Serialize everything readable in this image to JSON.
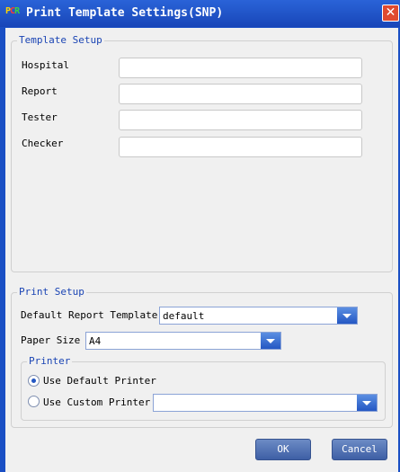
{
  "window": {
    "title": "Print Template Settings(SNP)",
    "icon_text": "PCR",
    "close_symbol": "✕"
  },
  "template_setup": {
    "legend": "Template Setup",
    "fields": [
      {
        "label": "Hospital",
        "value": ""
      },
      {
        "label": "Report",
        "value": ""
      },
      {
        "label": "Tester",
        "value": ""
      },
      {
        "label": "Checker",
        "value": ""
      }
    ]
  },
  "print_setup": {
    "legend": "Print Setup",
    "default_report_template_label": "Default Report Template",
    "default_report_template_value": "default",
    "paper_size_label": "Paper Size",
    "paper_size_value": "A4",
    "printer": {
      "legend": "Printer",
      "use_default_label": "Use Default Printer",
      "use_custom_label": "Use Custom Printer",
      "selected": "default",
      "custom_printer_value": ""
    }
  },
  "buttons": {
    "ok": "OK",
    "cancel": "Cancel"
  },
  "colors": {
    "title_bar": "#1a4fc4",
    "legend_text": "#1a44b4",
    "button": "#4e6fb3",
    "close": "#e04a2f"
  }
}
